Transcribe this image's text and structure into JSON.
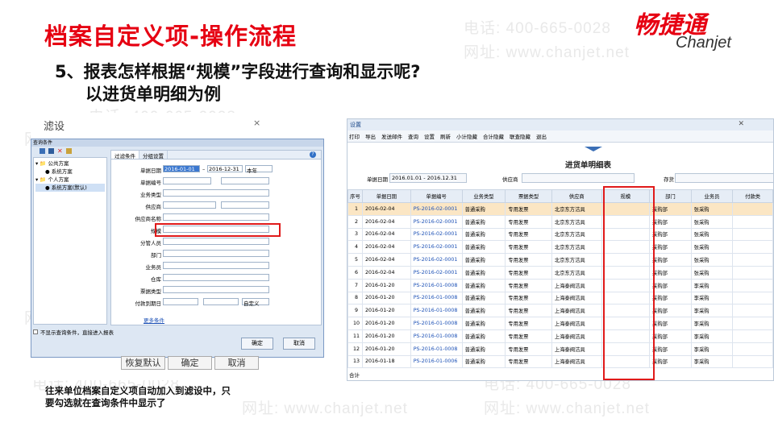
{
  "slide": {
    "title": "档案自定义项-操作流程",
    "subtitle_line1": "5、报表怎样根据“规模”字段进行查询和显示呢?",
    "subtitle_line2": "以进货单明细为例",
    "note": "往来单位档案自定义项自动加入到滤设中，只要勾选就在查询条件中显示了",
    "note_line1": "往来单位档案自定义项自动加入到滤设中，只",
    "note_line2": "要勾选就在查询条件中显示了"
  },
  "logo": {
    "cn": "畅捷通",
    "en": "Chanjet"
  },
  "watermark": {
    "phone": "电话: 400-665-0028",
    "web": "网址: www.chanjet.net"
  },
  "dialog": {
    "title": "滤设",
    "close": "×",
    "window_title": "查询条件",
    "tree": [
      "公共方案",
      "系统方案",
      "个人方案",
      "系统方案(默认)"
    ],
    "tabs": [
      "过滤条件",
      "分组设置"
    ],
    "fields": [
      {
        "label": "单据日期",
        "value": "2016-01-01",
        "value2": "2016-12-31",
        "extra": "本年"
      },
      {
        "label": "单据编号",
        "value": ""
      },
      {
        "label": "业务类型",
        "value": ""
      },
      {
        "label": "供应商",
        "value": ""
      },
      {
        "label": "供应商名称",
        "value": ""
      },
      {
        "label": "规模",
        "value": ""
      },
      {
        "label": "分管人员",
        "value": ""
      },
      {
        "label": "部门",
        "value": ""
      },
      {
        "label": "业务员",
        "value": ""
      },
      {
        "label": "仓库",
        "value": ""
      },
      {
        "label": "票据类型",
        "value": ""
      },
      {
        "label": "付款到期日",
        "value": "",
        "extra": "自定义"
      }
    ],
    "more_link": "更多条件",
    "checkbox_label": "不显示查询条件，直接进入报表",
    "ok": "确定",
    "cancel": "取消",
    "restore": "恢复默认",
    "ok_big": "确定",
    "cancel_big": "取消"
  },
  "report": {
    "window_title": "设置",
    "toolbar": [
      "打印",
      "导出",
      "发送邮件",
      "查询",
      "设置",
      "刷新",
      "小计隐藏",
      "合计隐藏",
      "联查隐藏",
      "退出"
    ],
    "heading": "进货单明细表",
    "cond_date_label": "单据日期",
    "cond_date_value": "2016.01.01 - 2016.12.31",
    "cond_supplier_label": "供应商",
    "cond_stock_label": "存货",
    "columns": [
      "序号",
      "单据日期",
      "单据编号",
      "业务类型",
      "票据类型",
      "供应商",
      "规模",
      "部门",
      "业务员",
      "付款类"
    ],
    "rows": [
      [
        "1",
        "2016-02-04",
        "PS-2016-02-0001",
        "普通采购",
        "专用发票",
        "北京东方洁具",
        "",
        "采购部",
        "张采购"
      ],
      [
        "2",
        "2016-02-04",
        "PS-2016-02-0001",
        "普通采购",
        "专用发票",
        "北京东方洁具",
        "",
        "采购部",
        "张采购"
      ],
      [
        "3",
        "2016-02-04",
        "PS-2016-02-0001",
        "普通采购",
        "专用发票",
        "北京东方洁具",
        "",
        "采购部",
        "张采购"
      ],
      [
        "4",
        "2016-02-04",
        "PS-2016-02-0001",
        "普通采购",
        "专用发票",
        "北京东方洁具",
        "",
        "采购部",
        "张采购"
      ],
      [
        "5",
        "2016-02-04",
        "PS-2016-02-0001",
        "普通采购",
        "专用发票",
        "北京东方洁具",
        "",
        "采购部",
        "张采购"
      ],
      [
        "6",
        "2016-02-04",
        "PS-2016-02-0001",
        "普通采购",
        "专用发票",
        "北京东方洁具",
        "",
        "采购部",
        "张采购"
      ],
      [
        "7",
        "2016-01-20",
        "PS-2016-01-0008",
        "普通采购",
        "专用发票",
        "上海泰阀洁具",
        "",
        "采购部",
        "李采购"
      ],
      [
        "8",
        "2016-01-20",
        "PS-2016-01-0008",
        "普通采购",
        "专用发票",
        "上海泰阀洁具",
        "",
        "采购部",
        "李采购"
      ],
      [
        "9",
        "2016-01-20",
        "PS-2016-01-0008",
        "普通采购",
        "专用发票",
        "上海泰阀洁具",
        "",
        "采购部",
        "李采购"
      ],
      [
        "10",
        "2016-01-20",
        "PS-2016-01-0008",
        "普通采购",
        "专用发票",
        "上海泰阀洁具",
        "",
        "采购部",
        "李采购"
      ],
      [
        "11",
        "2016-01-20",
        "PS-2016-01-0008",
        "普通采购",
        "专用发票",
        "上海泰阀洁具",
        "",
        "采购部",
        "李采购"
      ],
      [
        "12",
        "2016-01-20",
        "PS-2016-01-0008",
        "普通采购",
        "专用发票",
        "上海泰阀洁具",
        "",
        "采购部",
        "李采购"
      ],
      [
        "13",
        "2016-01-18",
        "PS-2016-01-0006",
        "普通采购",
        "专用发票",
        "上海泰阀洁具",
        "",
        "采购部",
        "李采购"
      ]
    ],
    "total_label": "合计"
  },
  "colors": {
    "brand_red": "#e60012",
    "highlight_box": "#e01a1a",
    "selected_row": "#fbe6c4"
  }
}
